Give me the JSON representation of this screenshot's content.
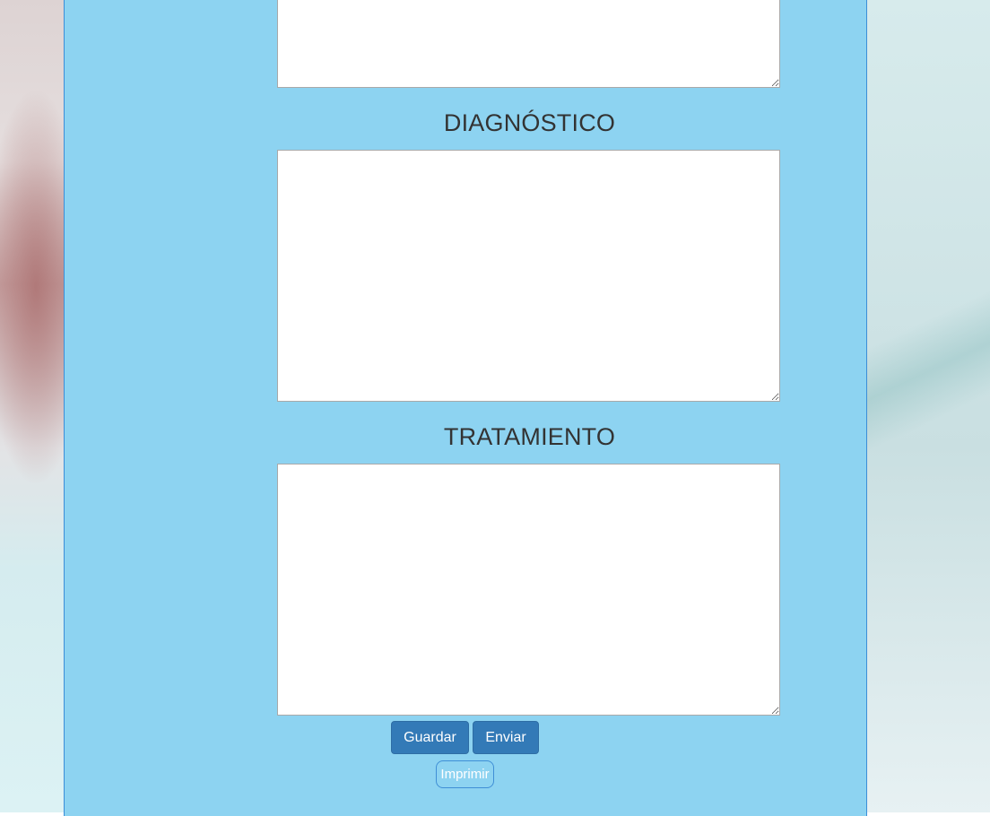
{
  "form": {
    "sections": [
      {
        "title": "DIAGNÓSTICO",
        "value": ""
      },
      {
        "title": "TRATAMIENTO",
        "value": ""
      }
    ],
    "previous_field": {
      "value": ""
    }
  },
  "actions": {
    "save_label": "Guardar",
    "send_label": "Enviar",
    "print_label": "Imprimir"
  },
  "colors": {
    "panel_bg": "#8dd3f1",
    "panel_border": "#3b8ed8",
    "primary_button": "#337ab7",
    "heading_text": "#333333"
  }
}
